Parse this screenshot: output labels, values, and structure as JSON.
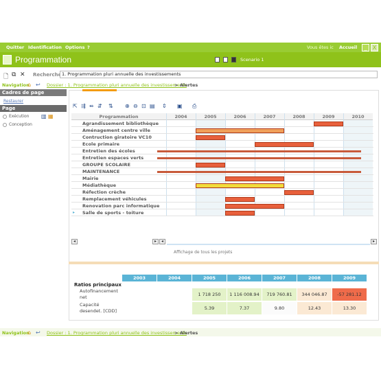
{
  "menu": {
    "items": [
      "Quitter",
      "Identification",
      "Options",
      "?"
    ],
    "user_text": "Vous êtes ic",
    "home_label": "Accueil",
    "minimize": "_",
    "close": "X"
  },
  "window": {
    "title": "Programmation",
    "scenario": "Scenario 1"
  },
  "search": {
    "label": "Recherche",
    "value": "1. Programmation pluri annuelle des investissements"
  },
  "nav": {
    "label": "Navigation",
    "crumb": "Dossier : 1. Programmation pluri annuelle des investissements",
    "separator": ">",
    "current": "Alertes"
  },
  "sidebar": {
    "cadres_header": "Cadres de page",
    "restaurer": "Restaurer",
    "page_header": "Page",
    "options": [
      "Exécution",
      "Conception"
    ]
  },
  "gantt": {
    "header_label": "Programmation",
    "years": [
      "2004",
      "2005",
      "2006",
      "2007",
      "2008",
      "2009",
      "2010"
    ],
    "rows": [
      {
        "label": "Agrandissement bibliothèque",
        "start": 2009,
        "end": 2010,
        "color": "#e8603c"
      },
      {
        "label": "Aménagement centre ville",
        "start": 2005,
        "end": 2008,
        "color": "#f0a05a"
      },
      {
        "label": "Contruction giratoire VC10",
        "start": 2005,
        "end": 2006,
        "color": "#e8603c"
      },
      {
        "label": "Ecole primaire",
        "start": 2007,
        "end": 2009,
        "color": "#e8603c"
      },
      {
        "label": "Entretien des écoles",
        "start": 2003.7,
        "end": 2010.6,
        "color": "#c85a3a",
        "thin": true
      },
      {
        "label": "Entretien espaces verts",
        "start": 2003.7,
        "end": 2010.6,
        "color": "#c85a3a",
        "thin": true
      },
      {
        "label": "GROUPE SCOLAIRE",
        "start": 2005,
        "end": 2006,
        "color": "#e8603c"
      },
      {
        "label": "MAINTENANCE",
        "start": 2003.7,
        "end": 2010.6,
        "color": "#c85a3a",
        "thin": true
      },
      {
        "label": "Mairie",
        "start": 2006,
        "end": 2008,
        "color": "#e8603c"
      },
      {
        "label": "Médiathèque",
        "start": 2005,
        "end": 2008,
        "color": "#f2dc3c"
      },
      {
        "label": "Réfection crèche",
        "start": 2008,
        "end": 2009,
        "color": "#e8603c"
      },
      {
        "label": "Remplacement véhicules",
        "start": 2006,
        "end": 2007,
        "color": "#e8603c"
      },
      {
        "label": "Renovation parc informatique",
        "start": 2006,
        "end": 2008,
        "color": "#e8603c"
      },
      {
        "label": "Salle de sports - toiture",
        "start": 2006,
        "end": 2007,
        "color": "#e8603c"
      }
    ],
    "show_all": "Affichage de tous les projets"
  },
  "ratios": {
    "title": "Ratios principaux",
    "years": [
      "2003",
      "2004",
      "2005",
      "2006",
      "2007",
      "2008",
      "2009"
    ],
    "rows": [
      {
        "label_line1": "Autofinancement",
        "label_line2": "net",
        "values": [
          "",
          "",
          "1 718 250",
          "1 116 008.94",
          "719 760.81",
          "344 046.87",
          "-57 281.12"
        ],
        "colors": [
          "",
          "",
          "#e3f2c8",
          "#e3f2c8",
          "#e3f2c8",
          "#fbe9d4",
          "#ef6b4a"
        ]
      },
      {
        "label_line1": "Capacité",
        "label_line2": "desendet. [CDD]",
        "values": [
          "",
          "",
          "5.39",
          "7.37",
          "9.80",
          "12.43",
          "13.30"
        ],
        "colors": [
          "",
          "",
          "#e3f2c8",
          "#e3f2c8",
          "#fbfbfb",
          "#fbe9d4",
          "#fbe9d4"
        ]
      }
    ]
  }
}
